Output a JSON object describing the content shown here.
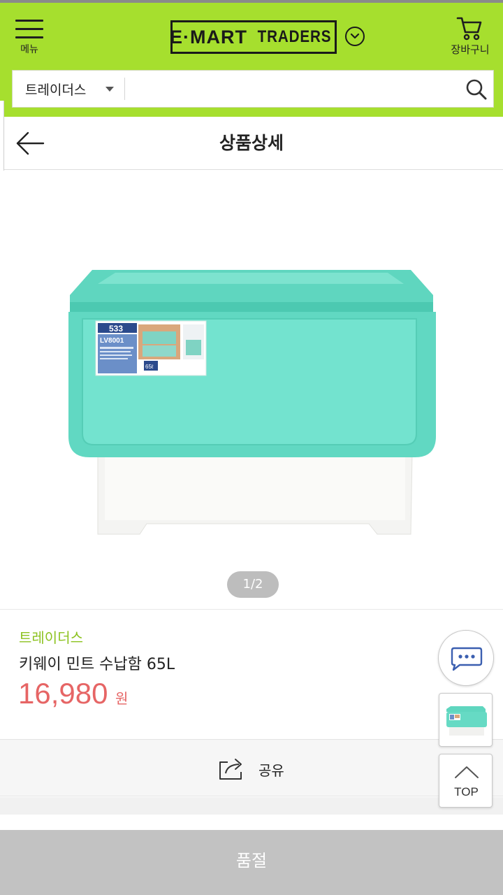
{
  "header": {
    "menu_label": "메뉴",
    "logo_text_a": "E·MART",
    "logo_text_b": "TRADERS",
    "cart_label": "장바구니",
    "background_color": "#a6df2e"
  },
  "search": {
    "scope_value": "트레이더스",
    "placeholder": ""
  },
  "titlebar": {
    "title": "상품상세"
  },
  "product": {
    "image_pager": "1/2",
    "label_sticker": {
      "number": "533",
      "code": "LV8001",
      "volume": "65ℓ"
    },
    "brand": "트레이더스",
    "name": "키웨이 민트 수납함 65L",
    "price": "16,980",
    "price_unit": "원",
    "brand_color": "#8cc21f",
    "price_color": "#e66565"
  },
  "actions": {
    "share_label": "공유",
    "top_label": "TOP",
    "soldout_label": "품절"
  },
  "icons": [
    "hamburger-icon",
    "chevron-down-icon",
    "cart-icon",
    "search-icon",
    "back-arrow-icon",
    "share-icon",
    "chat-icon",
    "chevron-up-icon"
  ]
}
